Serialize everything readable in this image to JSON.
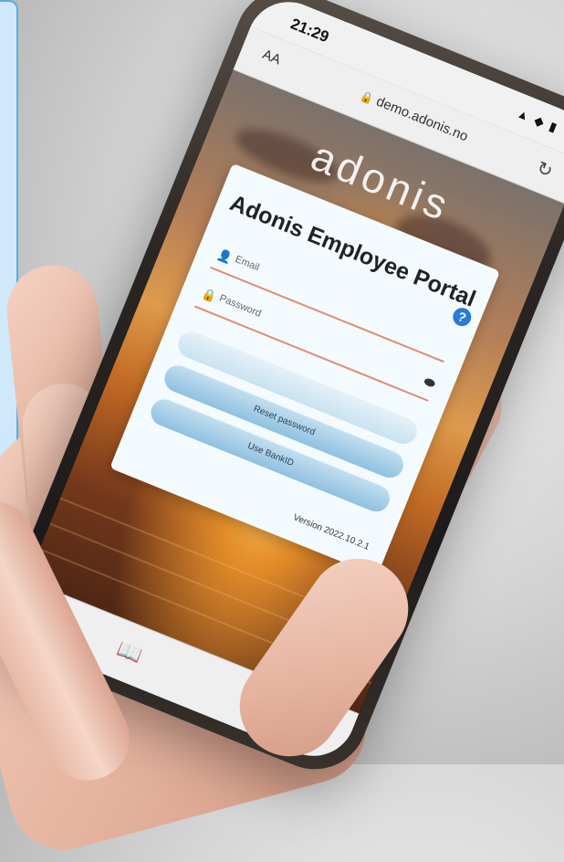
{
  "status_bar": {
    "time": "21:29",
    "icons": "▲ ◆ ▮"
  },
  "url_bar": {
    "aa": "AA",
    "domain": "demo.adonis.no"
  },
  "brand": {
    "logo": "adonis"
  },
  "login": {
    "title": "Adonis Employee Portal",
    "help": "?",
    "email_placeholder": "Email",
    "password_placeholder": "Password",
    "login_button": "",
    "reset_button": "Reset password",
    "bankid_button": "Use BankID",
    "version": "Version 2022.10.2.1"
  },
  "colors": {
    "accent": "#2b7bd6",
    "field_underline": "#e38a70",
    "button": "#8fc1e1",
    "sidebar_fill": "#cfe9fb",
    "sidebar_border": "#5aaee0"
  }
}
